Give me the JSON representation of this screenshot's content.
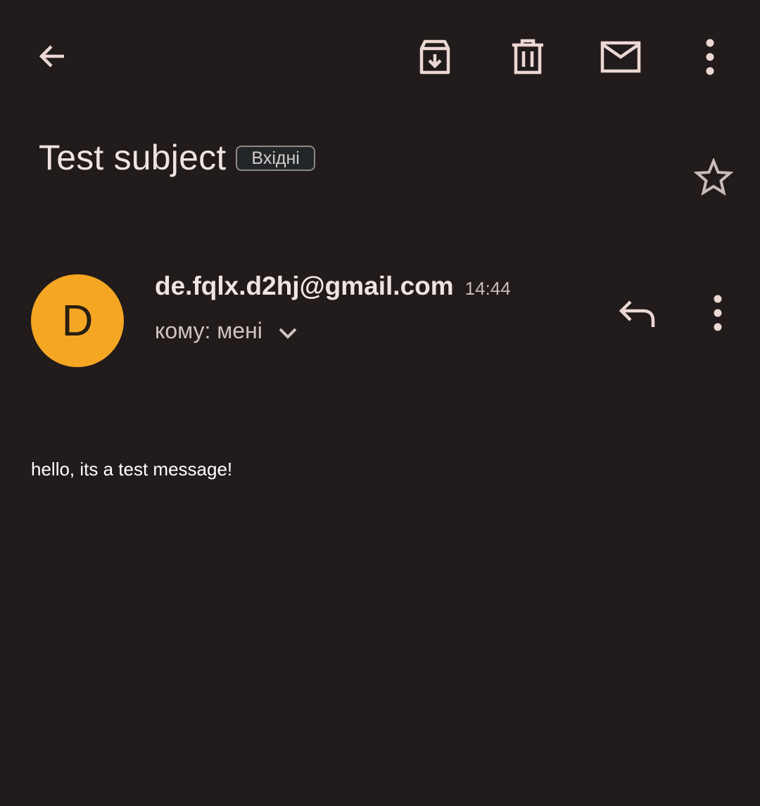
{
  "toolbar": {
    "back_icon": "arrow-left-icon",
    "archive_icon": "archive-icon",
    "delete_icon": "trash-icon",
    "mark_unread_icon": "mail-icon",
    "more_icon": "more-vert-icon"
  },
  "header": {
    "subject": "Test subject",
    "label": "Вхідні",
    "star_icon": "star-outline-icon"
  },
  "message": {
    "avatar_letter": "D",
    "avatar_color": "#f5a623",
    "sender": "de.fqlx.d2hj@gmail.com",
    "time": "14:44",
    "recipient": "кому: мені",
    "expand_icon": "chevron-down-icon",
    "reply_icon": "reply-icon",
    "more_icon": "more-vert-icon",
    "body": "hello, its a test message!"
  },
  "colors": {
    "background": "#211b1b",
    "icon": "#ecd8d3",
    "text_primary": "#efe4e1",
    "text_secondary": "#d1c3c0"
  }
}
